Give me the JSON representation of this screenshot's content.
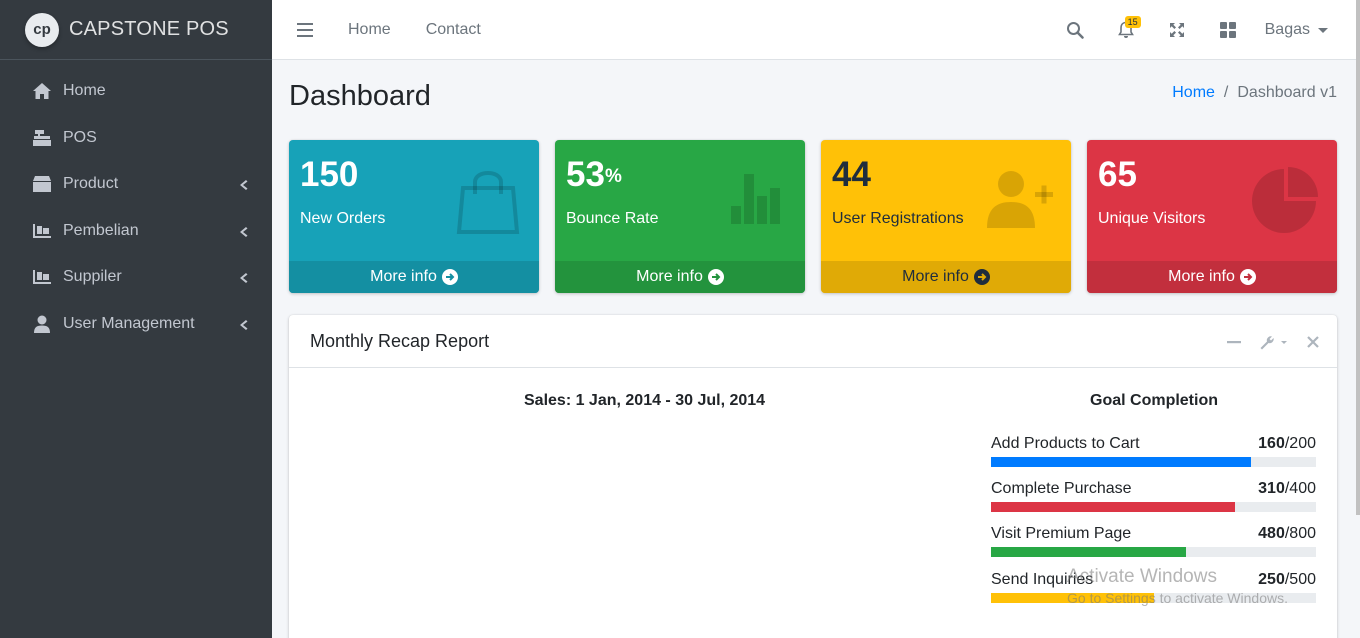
{
  "brand": {
    "logo_text": "cp",
    "name": "CAPSTONE POS"
  },
  "sidebar": {
    "items": [
      {
        "label": "Home",
        "icon": "home-icon",
        "has_children": false
      },
      {
        "label": "POS",
        "icon": "cash-register-icon",
        "has_children": false
      },
      {
        "label": "Product",
        "icon": "box-icon",
        "has_children": true
      },
      {
        "label": "Pembelian",
        "icon": "pallet-icon",
        "has_children": true
      },
      {
        "label": "Suppiler",
        "icon": "pallet-icon",
        "has_children": true
      },
      {
        "label": "User Management",
        "icon": "user-icon",
        "has_children": true
      }
    ]
  },
  "topbar": {
    "links": [
      "Home",
      "Contact"
    ],
    "notification_count": "15",
    "user_name": "Bagas"
  },
  "header": {
    "title": "Dashboard",
    "breadcrumb": {
      "home": "Home",
      "separator": "/",
      "current": "Dashboard v1"
    }
  },
  "boxes": [
    {
      "value": "150",
      "suffix": "",
      "label": "New Orders",
      "footer": "More info",
      "icon": "shopping-bag-icon",
      "color": "#17a2b8"
    },
    {
      "value": "53",
      "suffix": "%",
      "label": "Bounce Rate",
      "footer": "More info",
      "icon": "bar-chart-icon",
      "color": "#28a745"
    },
    {
      "value": "44",
      "suffix": "",
      "label": "User Registrations",
      "footer": "More info",
      "icon": "user-plus-icon",
      "color": "#ffc107"
    },
    {
      "value": "65",
      "suffix": "",
      "label": "Unique Visitors",
      "footer": "More info",
      "icon": "pie-chart-icon",
      "color": "#dc3545"
    }
  ],
  "card": {
    "title": "Monthly Recap Report",
    "sales_title": "Sales: 1 Jan, 2014 - 30 Jul, 2014",
    "goal_title": "Goal Completion",
    "goals": [
      {
        "label": "Add Products to Cart",
        "value": "160",
        "total": "/200",
        "percent": 80,
        "color": "#007bff"
      },
      {
        "label": "Complete Purchase",
        "value": "310",
        "total": "/400",
        "percent": 75,
        "color": "#dc3545"
      },
      {
        "label": "Visit Premium Page",
        "value": "480",
        "total": "/800",
        "percent": 60,
        "color": "#28a745"
      },
      {
        "label": "Send Inquiries",
        "value": "250",
        "total": "/500",
        "percent": 50,
        "color": "#ffc107"
      }
    ]
  },
  "watermark": {
    "line1": "Activate Windows",
    "line2": "Go to Settings to activate Windows."
  }
}
